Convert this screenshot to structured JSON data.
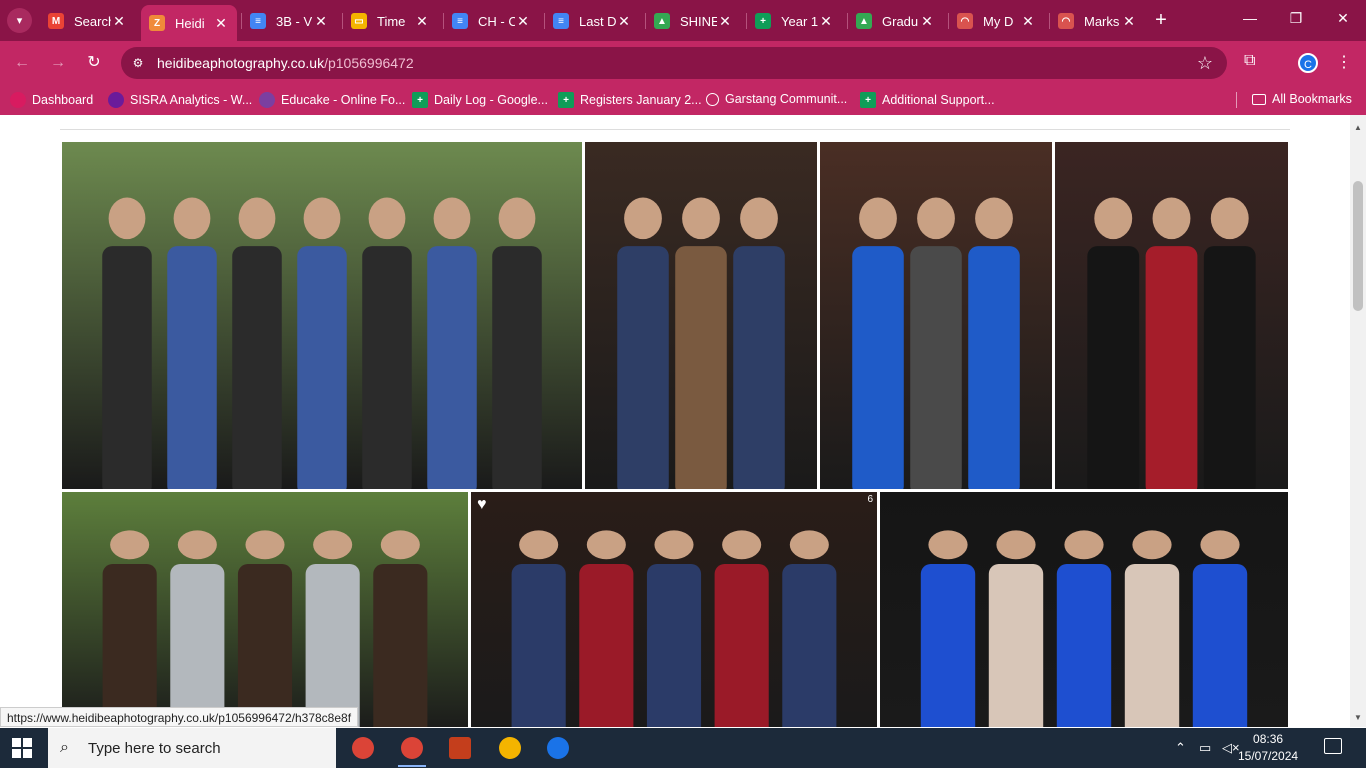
{
  "browser": {
    "tabs": [
      {
        "title": "Search",
        "icon": "gmail-icon",
        "color": "#ea4335",
        "letter": "M"
      },
      {
        "title": "Heidi",
        "icon": "zenfolio-icon",
        "color": "#f08a3a",
        "letter": "Z",
        "active": true
      },
      {
        "title": "3B - V",
        "icon": "docs-icon",
        "color": "#4285f4",
        "letter": "≡"
      },
      {
        "title": "Time",
        "icon": "slides-icon",
        "color": "#f4b400",
        "letter": "▭"
      },
      {
        "title": "CH - C",
        "icon": "docs-icon",
        "color": "#4285f4",
        "letter": "≡"
      },
      {
        "title": "Last D",
        "icon": "docs-icon",
        "color": "#4285f4",
        "letter": "≡"
      },
      {
        "title": "SHINE",
        "icon": "drive-icon",
        "color": "#34a853",
        "letter": "▲"
      },
      {
        "title": "Year 1",
        "icon": "sheets-icon",
        "color": "#0f9d58",
        "letter": "+"
      },
      {
        "title": "Gradu",
        "icon": "drive-icon",
        "color": "#34a853",
        "letter": "▲"
      },
      {
        "title": "My D",
        "icon": "rainbow-icon",
        "color": "#d9534f",
        "letter": "◠"
      },
      {
        "title": "Marks",
        "icon": "rainbow-icon",
        "color": "#d9534f",
        "letter": "◠"
      }
    ],
    "new_tab": "+",
    "address": {
      "domain": "heidibeaphotography.co.uk",
      "path": "/p1056996472"
    },
    "profile_letter": "C",
    "bookmarks": [
      {
        "label": "Dashboard",
        "icon": "dashboard-icon",
        "color": "#d81b60"
      },
      {
        "label": "SISRA Analytics - W...",
        "icon": "sisra-icon",
        "color": "#6a1b9a"
      },
      {
        "label": "Educake - Online Fo...",
        "icon": "educake-icon",
        "color": "#7b3fa0"
      },
      {
        "label": "Daily Log - Google...",
        "icon": "sheets-icon",
        "color": "#0f9d58"
      },
      {
        "label": "Registers January 2...",
        "icon": "sheets-icon",
        "color": "#0f9d58"
      },
      {
        "label": "Garstang Communit...",
        "icon": "globe-icon",
        "color": "#ffffff"
      },
      {
        "label": "Additional Support...",
        "icon": "sheets-icon",
        "color": "#0f9d58"
      }
    ],
    "all_bookmarks": "All Bookmarks"
  },
  "gallery": {
    "photos": [
      {
        "name": "photo-group-boys-suits",
        "palette": [
          "#6d8a4f",
          "#2b2b2b",
          "#3b5aa0"
        ]
      },
      {
        "name": "photo-boy-check-suit",
        "palette": [
          "#3a2a22",
          "#2e3e66",
          "#7a5a40"
        ]
      },
      {
        "name": "photo-two-girls-gowns",
        "palette": [
          "#4a2e24",
          "#1f5bc8",
          "#4a4a4a"
        ]
      },
      {
        "name": "photo-girl-black-dress",
        "palette": [
          "#3b2522",
          "#151515",
          "#a51d2a"
        ]
      },
      {
        "name": "photo-horse-carriage",
        "palette": [
          "#5d7f3c",
          "#3b2a20",
          "#b3b8bd"
        ]
      },
      {
        "name": "photo-four-boys-suits",
        "palette": [
          "#2a1d18",
          "#2b3b68",
          "#9a1a28"
        ],
        "count": "6"
      },
      {
        "name": "photo-three-girls",
        "palette": [
          "#151515",
          "#1e4fd0",
          "#d8c6b8"
        ]
      }
    ]
  },
  "status_url": "https://www.heidibeaphotography.co.uk/p1056996472/h378c8e8f",
  "taskbar": {
    "search_placeholder": "Type here to search",
    "apps": [
      {
        "name": "chrome-icon",
        "color": "#db4437"
      },
      {
        "name": "chrome-profile-icon",
        "color": "#db4437",
        "active": true
      },
      {
        "name": "powerpoint-icon",
        "color": "#c43e1c"
      },
      {
        "name": "chrome-alt-icon",
        "color": "#f4b400"
      },
      {
        "name": "maps-pin-icon",
        "color": "#1a73e8"
      }
    ],
    "time": "08:36",
    "date": "15/07/2024"
  }
}
